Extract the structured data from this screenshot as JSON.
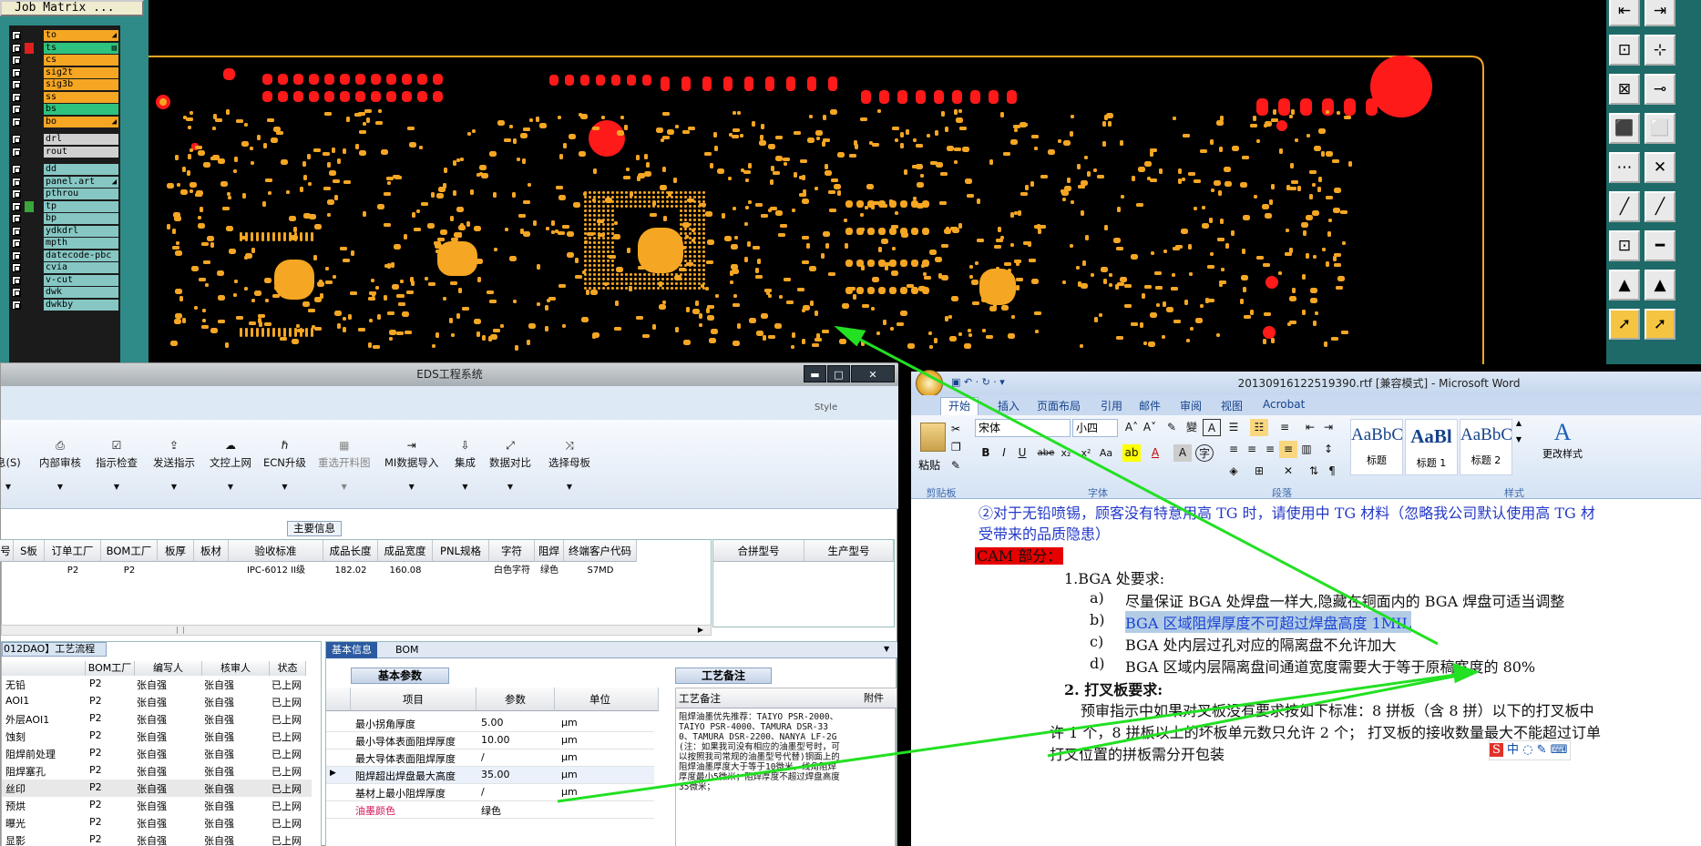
{
  "job_matrix": {
    "title": "Job Matrix ...",
    "layers": [
      {
        "name": "to",
        "color": "#f5a623",
        "arrow": "◢"
      },
      {
        "name": "ts",
        "color": "#2ec27e",
        "arrow": "▤"
      },
      {
        "name": "cs",
        "color": "#f5a623"
      },
      {
        "name": "sig2t",
        "color": "#f5a623"
      },
      {
        "name": "sig3b",
        "color": "#f5a623"
      },
      {
        "name": "ss",
        "color": "#f5a623"
      },
      {
        "name": "bs",
        "color": "#2ec27e"
      },
      {
        "name": "bo",
        "color": "#f5a623",
        "arrow": "◢"
      },
      {
        "name": "drl",
        "color": "#d0d0d0"
      },
      {
        "name": "rout",
        "color": "#d0d0d0"
      },
      {
        "name": "dd",
        "color": "#86c7c4"
      },
      {
        "name": "panel.art",
        "color": "#86c7c4",
        "arrow": "◢"
      },
      {
        "name": "pthrou",
        "color": "#86c7c4"
      },
      {
        "name": "tp",
        "color": "#86c7c4"
      },
      {
        "name": "bp",
        "color": "#86c7c4"
      },
      {
        "name": "ydkdrl",
        "color": "#86c7c4"
      },
      {
        "name": "mpth",
        "color": "#86c7c4"
      },
      {
        "name": "datecode-pbc",
        "color": "#86c7c4"
      },
      {
        "name": "cvia",
        "color": "#86c7c4"
      },
      {
        "name": "v-cut",
        "color": "#86c7c4"
      },
      {
        "name": "dwk",
        "color": "#86c7c4"
      },
      {
        "name": "dwkby",
        "color": "#86c7c4"
      }
    ]
  },
  "eds": {
    "title": "EDS工程系统",
    "style_label": "Style",
    "ribbon": [
      {
        "label": "息(S)",
        "icon": ""
      },
      {
        "label": "内部审核",
        "icon": "⎙"
      },
      {
        "label": "指示检查",
        "icon": "☑"
      },
      {
        "label": "发送指示",
        "icon": "⇪"
      },
      {
        "label": "文控上网",
        "icon": "☁"
      },
      {
        "label": "ECN升级",
        "icon": "ℏ"
      },
      {
        "label": "重选开料图",
        "icon": "▦"
      },
      {
        "label": "MI数据导入",
        "icon": "⇥"
      },
      {
        "label": "集成",
        "icon": "⇩"
      },
      {
        "label": "数据对比",
        "icon": "⤢"
      },
      {
        "label": "选择母板",
        "icon": "⤨"
      }
    ],
    "main_info_label": "主要信息",
    "grid_headers": [
      "号",
      "S板",
      "订单工厂",
      "BOM工厂",
      "板厚",
      "板材",
      "验收标准",
      "成品长度",
      "成品宽度",
      "PNL规格",
      "字符",
      "阻焊",
      "终端客户代码"
    ],
    "grid_row": [
      "",
      "",
      "P2",
      "P2",
      "",
      "",
      "IPC-6012 II级",
      "182.02",
      "160.08",
      "",
      "白色字符",
      "绿色",
      "S7MD"
    ],
    "grid2_headers": [
      "合拼型号",
      "生产型号"
    ],
    "process_title": "012DAO】工艺流程",
    "process_headers": [
      "",
      "BOM工厂",
      "编写人",
      "核审人",
      "状态"
    ],
    "process_rows": [
      [
        "无铅",
        "P2",
        "张自强",
        "张自强",
        "已上网"
      ],
      [
        "AOI1",
        "P2",
        "张自强",
        "张自强",
        "已上网"
      ],
      [
        "外层AOI1",
        "P2",
        "张自强",
        "张自强",
        "已上网"
      ],
      [
        "蚀刻",
        "P2",
        "张自强",
        "张自强",
        "已上网"
      ],
      [
        "阻焊前处理",
        "P2",
        "张自强",
        "张自强",
        "已上网"
      ],
      [
        "阻焊塞孔",
        "P2",
        "张自强",
        "张自强",
        "已上网"
      ],
      [
        "丝印",
        "P2",
        "张自强",
        "张自强",
        "已上网"
      ],
      [
        "预烘",
        "P2",
        "张自强",
        "张自强",
        "已上网"
      ],
      [
        "曝光",
        "P2",
        "张自强",
        "张自强",
        "已上网"
      ],
      [
        "显影",
        "P2",
        "张自强",
        "张自强",
        "已上网"
      ]
    ],
    "basic_tabs": [
      "基本信息",
      "BOM"
    ],
    "basic_params_title": "基本参数",
    "params_headers": [
      "项目",
      "参数",
      "单位"
    ],
    "params": [
      {
        "item": "最小拐角厚度",
        "value": "5.00",
        "unit": "μm"
      },
      {
        "item": "最小导体表面阻焊厚度",
        "value": "10.00",
        "unit": "μm"
      },
      {
        "item": "最大导体表面阻焊厚度",
        "value": "/",
        "unit": "μm"
      },
      {
        "item": "阻焊超出焊盘最大高度",
        "value": "35.00",
        "unit": "μm"
      },
      {
        "item": "基材上最小阻焊厚度",
        "value": "/",
        "unit": "μm"
      },
      {
        "item": "油墨颜色",
        "value": "绿色",
        "unit": ""
      }
    ],
    "craft_note_title": "工艺备注",
    "craft_note_col": "工艺备注",
    "craft_note_col2": "附件",
    "craft_note_text": "阻焊油墨优先推荐：TAIYO PSR-2000、TAIYO PSR-4000、TAMURA DSR-330、TAMURA DSR-2200、NANYA LF-2G(注：如果我司没有相应的油墨型号时，可以按照我司常规的油墨型号代替)铜面上的阻焊油墨厚度大于等于10微米，线角阻焊厚度最小5微米；阻焊厚度不超过焊盘高度35微米；"
  },
  "word": {
    "title": "20130916122519390.rtf [兼容模式] - Microsoft Word",
    "tabs": [
      "开始",
      "插入",
      "页面布局",
      "引用",
      "邮件",
      "审阅",
      "视图",
      "Acrobat"
    ],
    "font_name": "宋体",
    "font_size": "小四",
    "groups": [
      "剪贴板",
      "字体",
      "段落",
      "样式"
    ],
    "paste_label": "粘贴",
    "styles": [
      {
        "sample": "AaBbC",
        "label": "标题"
      },
      {
        "sample": "AaBl",
        "label": "标题 1"
      },
      {
        "sample": "AaBbC",
        "label": "标题 2"
      }
    ],
    "change_styles": "更改样式",
    "doc": {
      "line1": "②对于无铅喷锡，顾客没有特意用高 TG 时，请使用中 TG 材料（忽略我公司默认使用高 TG 材",
      "line2": "受带来的品质隐患）",
      "cam_label": "CAM 部分：",
      "bga_heading": "1.BGA 处要求:",
      "items": [
        {
          "mark": "a)",
          "text": "尽量保证 BGA 处焊盘一样大,隐藏在铜面内的 BGA 焊盘可适当调整"
        },
        {
          "mark": "b)",
          "text": "BGA 区域阻焊厚度不可超过焊盘高度 1MIL"
        },
        {
          "mark": "c)",
          "text": "BGA 处内层过孔对应的隔离盘不允许加大"
        },
        {
          "mark": "d)",
          "text": "BGA 区域内层隔离盘间通道宽度需要大于等于原稿宽度的 80%"
        }
      ],
      "heading2": "2. 打叉板要求:",
      "para1": "预审指示中如果对叉板没有要求按如下标准：8 拼板（含 8 拼）以下的打叉板中",
      "para2": "许 1 个，8 拼板以上的坏板单元数只允许 2 个；  打叉板的接收数量最大不能超过订单",
      "para3": "打叉位置的拼板需分开包装"
    },
    "ime_label": "中"
  },
  "colors": {
    "pad": "#f5a623",
    "pad_red": "#ff1a1a",
    "arrow": "#22e022",
    "highlight": "#b3cce6"
  }
}
